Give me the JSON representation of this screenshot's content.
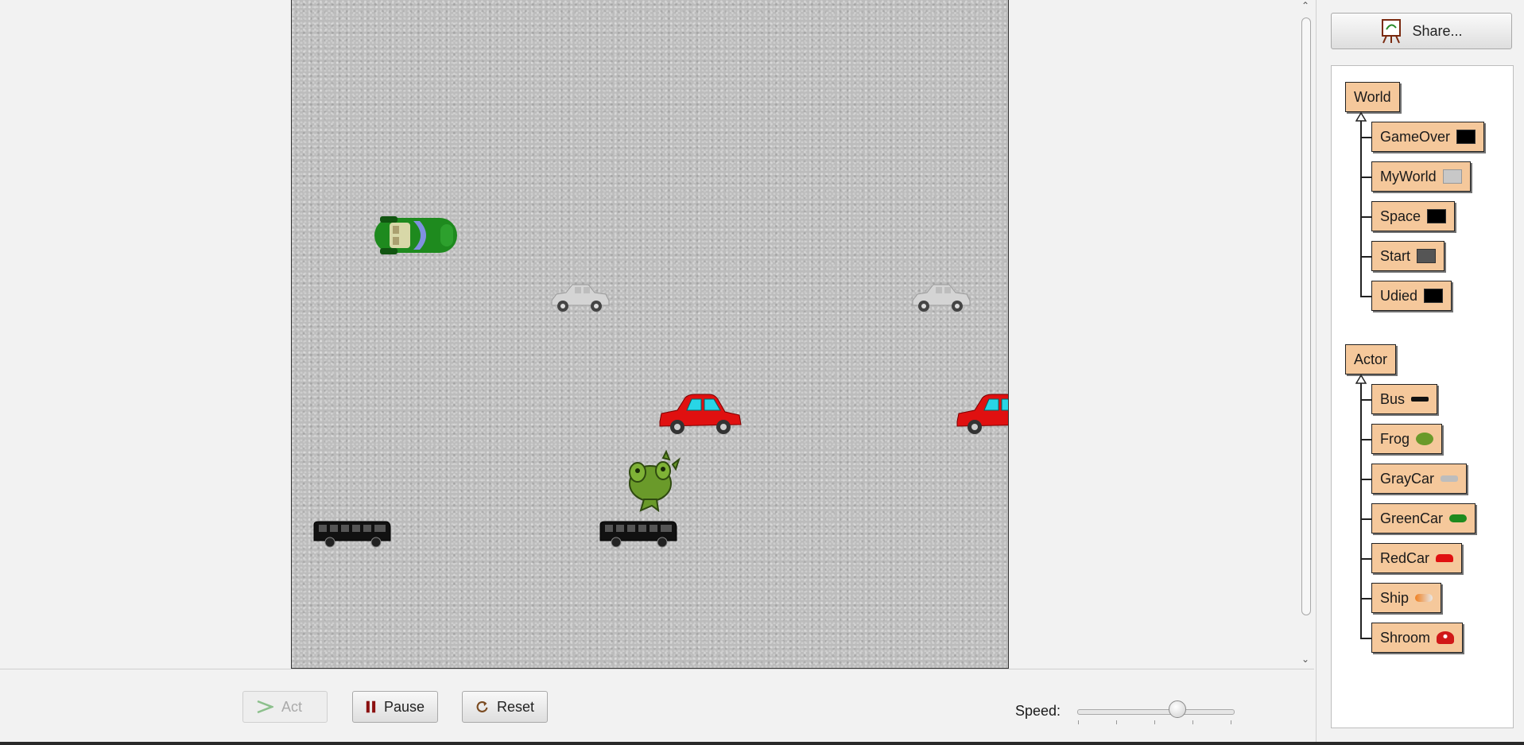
{
  "controls": {
    "act_label": "Act",
    "pause_label": "Pause",
    "reset_label": "Reset",
    "speed_label": "Speed:",
    "speed_value": 0.5
  },
  "share": {
    "label": "Share..."
  },
  "class_tree": {
    "world_root": "World",
    "world_subclasses": [
      "GameOver",
      "MyWorld",
      "Space",
      "Start",
      "Udied"
    ],
    "actor_root": "Actor",
    "actor_subclasses": [
      "Bus",
      "Frog",
      "GrayCar",
      "GreenCar",
      "RedCar",
      "Ship",
      "Shroom"
    ]
  },
  "colors": {
    "class_box": "#f5c89b",
    "red_car": "#e01010",
    "green_car": "#1e8a1e",
    "frog": "#6a9a2a"
  }
}
